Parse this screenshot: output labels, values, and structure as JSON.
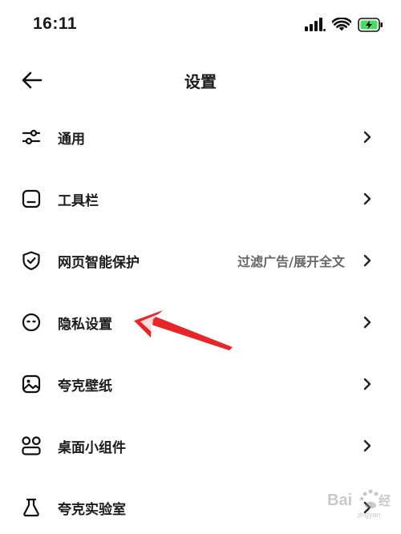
{
  "status_bar": {
    "time": "16:11",
    "icons": [
      "signal-icon",
      "wifi-icon",
      "battery-charging-icon"
    ],
    "battery_color": "#4cd964"
  },
  "header": {
    "title": "设置",
    "back_icon": "arrow-left-icon"
  },
  "settings": {
    "items": [
      {
        "label": "通用",
        "icon": "sliders-icon",
        "value": ""
      },
      {
        "label": "工具栏",
        "icon": "toolbar-icon",
        "value": ""
      },
      {
        "label": "网页智能保护",
        "icon": "shield-check-icon",
        "value": "过滤广告/展开全文"
      },
      {
        "label": "隐私设置",
        "icon": "privacy-face-icon",
        "value": ""
      },
      {
        "label": "夸克壁纸",
        "icon": "wallpaper-icon",
        "value": ""
      },
      {
        "label": "桌面小组件",
        "icon": "widgets-icon",
        "value": ""
      },
      {
        "label": "夸克实验室",
        "icon": "flask-icon",
        "value": ""
      }
    ]
  },
  "annotation": {
    "color": "#e8262a",
    "points_to": "隐私设置"
  },
  "watermark": {
    "text": "Baidu经验"
  }
}
